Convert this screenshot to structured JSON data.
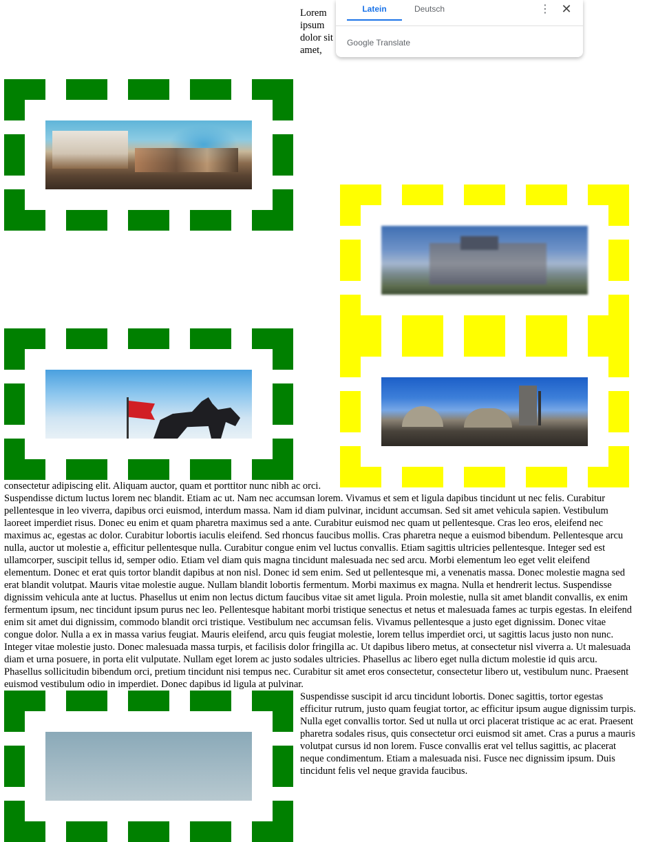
{
  "translate_popup": {
    "tabs": [
      {
        "label": "Latein",
        "active": true
      },
      {
        "label": "Deutsch",
        "active": false
      }
    ],
    "brand_google": "Google",
    "brand_translate": "Translate",
    "more_icon": "⋮",
    "close_icon": "✕"
  },
  "colors": {
    "green_frame": "#008000",
    "yellow_frame": "#ffff00",
    "active_tab": "#1a73e8"
  },
  "paragraphs": [
    "Lorem ipsum dolor sit amet, consectetur adipiscing elit. Aliquam auctor, quam et porttitor nunc nibh ac orci. Suspendisse dictum luctus lorem nec blandit. Etiam ac ut. Nam nec accumsan lorem. Vivamus et sem et ligula dapibus tincidunt ut nec felis. Curabitur pellentesque in leo viverra, dapibus orci euismod, interdum massa. Nam id diam pulvinar, incidunt accumsan. Sed sit amet vehicula sapien. Vestibulum laoreet imperdiet risus. Donec eu enim et quam pharetra maximus sed a ante. Curabitur euismod nec quam ut pellentesque. Cras leo eros, eleifend nec maximus ac, egestas ac dolor. Curabitur lobortis iaculis eleifend. Sed rhoncus faucibus mollis. Cras pharetra neque a euismod bibendum. Pellentesque arcu nulla, auctor ut molestie a, efficitur pellentesque nulla. Curabitur congue enim vel luctus convallis. Etiam sagittis ultricies pellentesque. Integer sed est ullamcorper, suscipit tellus id, semper odio. Etiam vel diam quis magna tincidunt malesuada nec sed arcu. Morbi elementum leo eget velit eleifend elementum. Donec et erat quis tortor blandit dapibus at non nisl. Donec id sem enim. Sed ut pellentesque mi, a venenatis massa. Donec molestie magna sed erat blandit volutpat. Mauris vitae molestie augue. Nullam blandit lobortis fermentum. Morbi maximus ex magna. Nulla et hendrerit lectus. Suspendisse dignissim vehicula ante at luctus. Phasellus ut enim non lectus dictum faucibus vitae sit amet ligula. Proin molestie, nulla sit amet blandit convallis, ex enim fermentum ipsum, nec tincidunt ipsum purus nec leo. Pellentesque habitant morbi tristique senectus et netus et malesuada fames ac turpis egestas. In eleifend enim sit amet dui dignissim, commodo blandit orci tristique. Vestibulum nec accumsan felis. Vivamus pellentesque a justo eget dignissim. Donec vitae congue dolor. Nulla a ex in massa varius feugiat. Mauris eleifend, arcu quis feugiat molestie, lorem tellus imperdiet orci, ut sagittis lacus justo non nunc. Integer vitae molestie justo. Donec malesuada massa turpis, et facilisis dolor fringilla ac. Ut dapibus libero metus, at consectetur nisl viverra a. Ut malesuada diam et urna posuere, in porta elit vulputate. Nullam eget lorem ac justo sodales ultricies. Phasellus ac libero eget nulla dictum molestie id quis arcu. Phasellus sollicitudin bibendum orci, pretium tincidunt nisi tempus nec. Curabitur sit amet eros consectetur, consectetur libero ut, vestibulum nunc. Praesent euismod vestibulum odio in imperdiet. Donec dapibus id ligula at pulvinar.",
    "Suspendisse suscipit id arcu tincidunt lobortis. Donec sagittis, tortor egestas efficitur rutrum, justo quam feugiat tortor, ac efficitur ipsum augue dignissim turpis. Nulla eget convallis tortor. Sed ut nulla ut orci placerat tristique ac ac erat. Praesent pharetra sodales risus, quis consectetur orci euismod sit amet. Cras a purus a mauris volutpat cursus id non lorem. Fusce convallis erat vel tellus sagittis, ac placerat neque condimentum. Etiam a malesuada nisi. Fusce nec dignissim ipsum. Duis tincidunt felis vel neque gravida faucibus."
  ]
}
